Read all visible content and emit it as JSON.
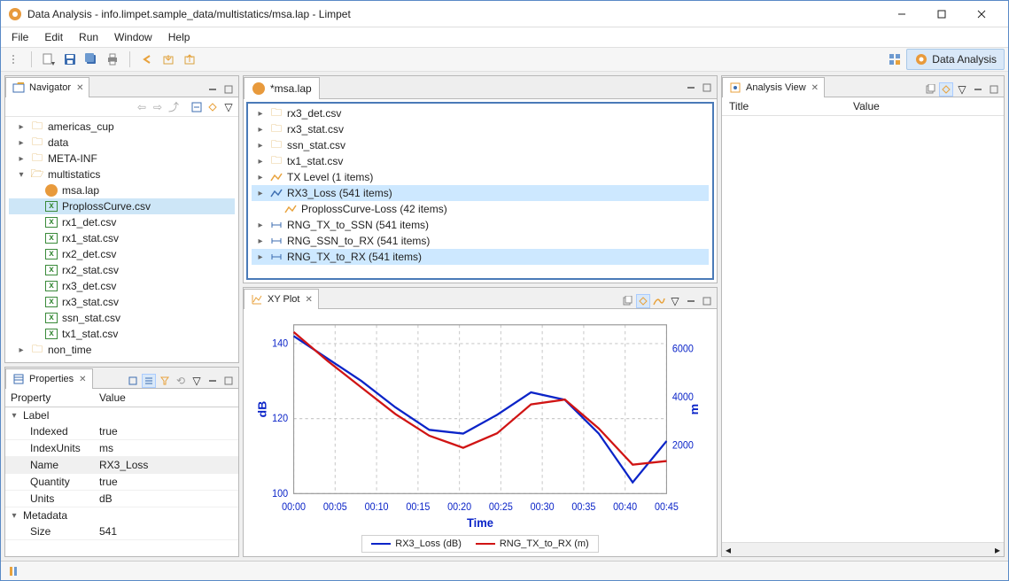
{
  "window": {
    "title": "Data Analysis - info.limpet.sample_data/multistatics/msa.lap - Limpet"
  },
  "menubar": [
    "File",
    "Edit",
    "Run",
    "Window",
    "Help"
  ],
  "perspective": {
    "label": "Data Analysis"
  },
  "navigator": {
    "title": "Navigator",
    "tree": {
      "americas_cup": "americas_cup",
      "data": "data",
      "meta": "META-INF",
      "multistatics": "multistatics",
      "msa": "msa.lap",
      "proploss": "ProplossCurve.csv",
      "rx1det": "rx1_det.csv",
      "rx1stat": "rx1_stat.csv",
      "rx2det": "rx2_det.csv",
      "rx2stat": "rx2_stat.csv",
      "rx3det": "rx3_det.csv",
      "rx3stat": "rx3_stat.csv",
      "ssnstat": "ssn_stat.csv",
      "tx1stat": "tx1_stat.csv",
      "nontime": "non_time"
    }
  },
  "properties": {
    "title": "Properties",
    "columns": {
      "prop": "Property",
      "val": "Value"
    },
    "groups": {
      "label": "Label",
      "metadata": "Metadata"
    },
    "rows": {
      "indexed": {
        "k": "Indexed",
        "v": "true"
      },
      "indexunits": {
        "k": "IndexUnits",
        "v": "ms"
      },
      "name": {
        "k": "Name",
        "v": "RX3_Loss"
      },
      "quantity": {
        "k": "Quantity",
        "v": "true"
      },
      "units": {
        "k": "Units",
        "v": "dB"
      },
      "size": {
        "k": "Size",
        "v": "541"
      }
    }
  },
  "editor": {
    "tab": "*msa.lap",
    "items": {
      "rx3det": "rx3_det.csv",
      "rx3stat": "rx3_stat.csv",
      "ssnstat": "ssn_stat.csv",
      "tx1stat": "tx1_stat.csv",
      "txlevel": "TX Level (1 items)",
      "rx3loss": "RX3_Loss (541 items)",
      "proploss": "ProplossCurve-Loss (42 items)",
      "rng_tx_ssn": "RNG_TX_to_SSN (541 items)",
      "rng_ssn_rx": "RNG_SSN_to_RX (541 items)",
      "rng_tx_rx": "RNG_TX_to_RX (541 items)"
    }
  },
  "xyplot": {
    "title": "XY Plot",
    "xlabel": "Time",
    "ylabel_left": "dB",
    "ylabel_right": "m",
    "legend": {
      "s1": "RX3_Loss (dB)",
      "s2": "RNG_TX_to_RX (m)"
    }
  },
  "analysis": {
    "title": "Analysis View",
    "columns": {
      "c1": "Title",
      "c2": "Value"
    }
  },
  "chart_data": {
    "type": "line",
    "xlabel": "Time",
    "x": [
      "00:00",
      "00:05",
      "00:10",
      "00:15",
      "00:20",
      "00:25",
      "00:30",
      "00:35",
      "00:40",
      "00:45"
    ],
    "left_axis": {
      "label": "dB",
      "ylim": [
        100,
        145
      ],
      "ticks": [
        100,
        120,
        140
      ]
    },
    "right_axis": {
      "label": "m",
      "ylim": [
        0,
        7000
      ],
      "ticks": [
        2000,
        4000,
        6000
      ]
    },
    "series": [
      {
        "name": "RX3_Loss (dB)",
        "axis": "left",
        "color": "#0b24c8",
        "values": [
          142,
          136,
          130,
          123,
          117,
          116,
          121,
          127,
          125,
          116,
          103,
          114
        ]
      },
      {
        "name": "RNG_TX_to_RX (m)",
        "axis": "right",
        "color": "#d01414",
        "values": [
          6700,
          5500,
          4400,
          3300,
          2400,
          1900,
          2500,
          3700,
          3900,
          2700,
          1200,
          1350
        ]
      }
    ]
  }
}
